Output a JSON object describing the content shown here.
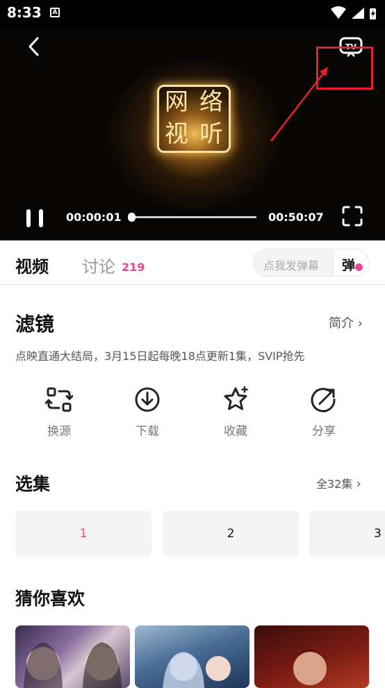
{
  "status_bar": {
    "time": "8:33",
    "notif_icon": "A"
  },
  "player": {
    "current_time": "00:00:01",
    "total_time": "00:50:07",
    "progress_fraction": 0.0003,
    "logo_chars": [
      "网",
      "络",
      "视",
      "听"
    ]
  },
  "tabs": {
    "video": "视频",
    "discuss": "讨论",
    "discuss_count": "219"
  },
  "danmu": {
    "placeholder": "点我发弹幕",
    "button": "弹"
  },
  "show": {
    "title": "滤镜",
    "intro_link": "简介",
    "description": "点映直通大结局，3月15日起每晚18点更新1集，SVIP抢先"
  },
  "actions": [
    {
      "label": "换源",
      "icon": "switch-source-icon"
    },
    {
      "label": "下载",
      "icon": "download-icon"
    },
    {
      "label": "收藏",
      "icon": "star-icon"
    },
    {
      "label": "分享",
      "icon": "share-icon"
    }
  ],
  "episodes": {
    "title": "选集",
    "all_label": "全32集",
    "items": [
      "1",
      "2",
      "3"
    ],
    "selected": "1"
  },
  "recommend": {
    "title": "猜你喜欢"
  },
  "colors": {
    "accent": "#f0439a",
    "annotation": "#e8202a"
  }
}
